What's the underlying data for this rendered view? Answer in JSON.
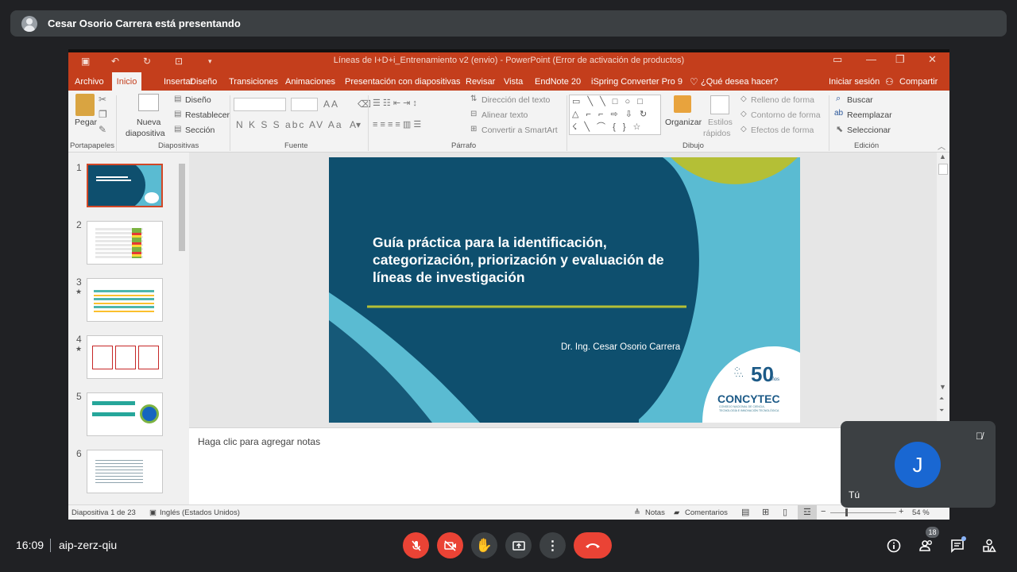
{
  "meet": {
    "presenter_label": "Cesar Osorio Carrera está presentando",
    "time": "16:09",
    "meeting_code": "aip-zerz-qiu",
    "self_initial": "J",
    "self_name": "Tú",
    "participant_count": "18",
    "colors": {
      "leave": "#ea4335",
      "avatar": "#1967d2",
      "bar": "#3c4043"
    },
    "icons": [
      "mic-off-icon",
      "camera-off-icon",
      "raise-hand-icon",
      "present-icon",
      "more-options-icon",
      "leave-call-icon",
      "info-icon",
      "people-icon",
      "chat-icon",
      "activities-icon"
    ]
  },
  "ppt": {
    "window_title": "Líneas de I+D+i_Entrenamiento v2 (envio) - PowerPoint (Error de activación de productos)",
    "tabs": {
      "archivo": "Archivo",
      "inicio": "Inicio",
      "insertar": "Insertar",
      "diseno": "Diseño",
      "transiciones": "Transiciones",
      "animaciones": "Animaciones",
      "presentacion": "Presentación con diapositivas",
      "revisar": "Revisar",
      "vista": "Vista",
      "endnote": "EndNote 20",
      "ispring": "iSpring Converter Pro 9",
      "tell_me": "¿Qué desea hacer?",
      "sign_in": "Iniciar sesión",
      "share": "Compartir"
    },
    "ribbon": {
      "pegar": "Pegar",
      "nueva_1": "Nueva",
      "nueva_2": "diapositiva",
      "diseno": "Diseño",
      "restablecer": "Restablecer",
      "seccion": "Sección",
      "direccion_texto": "Dirección del texto",
      "alinear_texto": "Alinear texto",
      "convertir_smartart": "Convertir a SmartArt",
      "organizar": "Organizar",
      "estilos_1": "Estilos",
      "estilos_2": "rápidos",
      "relleno": "Relleno de forma",
      "contorno": "Contorno de forma",
      "efectos": "Efectos de forma",
      "buscar": "Buscar",
      "reemplazar": "Reemplazar",
      "seleccionar": "Seleccionar",
      "font_buttons": "N K S S abc AV Aa",
      "groups": {
        "portapapeles": "Portapapeles",
        "diapositivas": "Diapositivas",
        "fuente": "Fuente",
        "parrafo": "Párrafo",
        "dibujo": "Dibujo",
        "edicion": "Edición"
      }
    },
    "thumbnails": [
      {
        "num": "1",
        "star": ""
      },
      {
        "num": "2",
        "star": ""
      },
      {
        "num": "3",
        "star": "★"
      },
      {
        "num": "4",
        "star": "★"
      },
      {
        "num": "5",
        "star": ""
      },
      {
        "num": "6",
        "star": ""
      }
    ],
    "slide": {
      "title": "Guía práctica para la identificación, categorización, priorización y evaluación de líneas de investigación",
      "author": "Dr. Ing. Cesar Osorio Carrera",
      "logo_years": "50",
      "logo_years_small": "años",
      "logo_name": "CONCYTEC",
      "logo_sub1": "CONSEJO NACIONAL DE CIENCIA,",
      "logo_sub2": "TECNOLOGÍA E INNOVACIÓN TECNOLÓGICA",
      "colors": {
        "dark": "#0e4f6e",
        "light": "#5abbd2",
        "accent": "#b4bf36"
      }
    },
    "notes_placeholder": "Haga clic para agregar notas",
    "status": {
      "slide_info": "Diapositiva 1 de 23",
      "language": "Inglés (Estados Unidos)",
      "notas": "Notas",
      "comentarios": "Comentarios",
      "zoom": "54 %"
    }
  }
}
